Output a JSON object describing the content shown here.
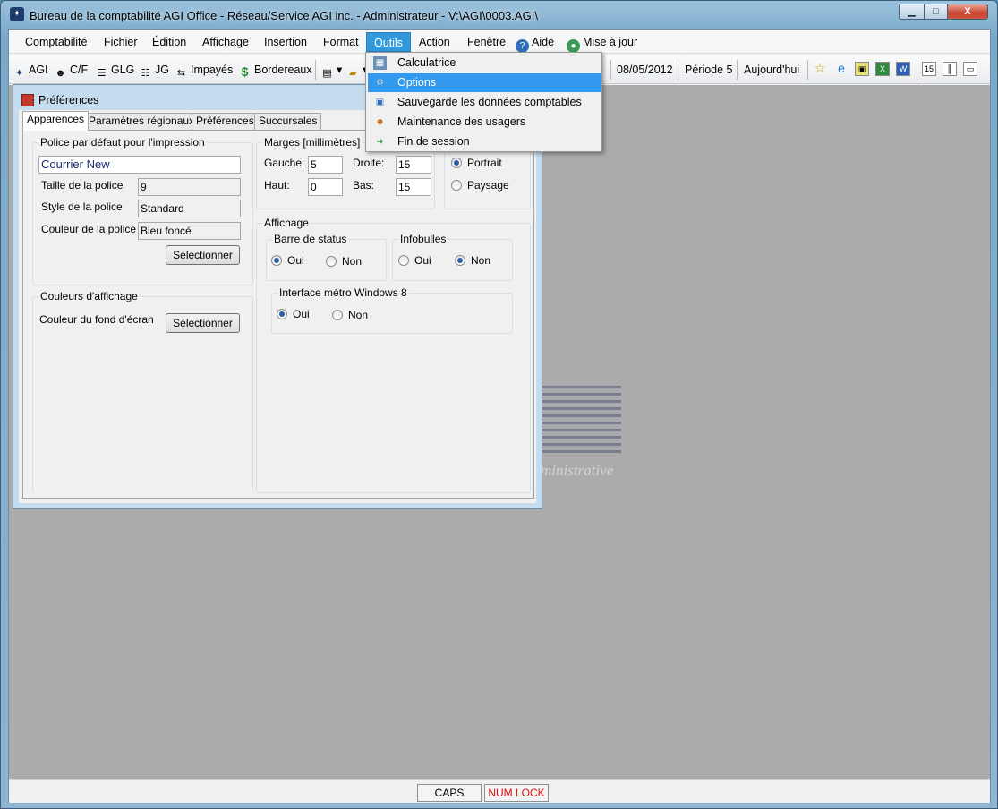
{
  "window": {
    "title": "Bureau de la comptabilité AGI Office - Réseau/Service AGI inc. - Administrateur - V:\\AGI\\0003.AGI\\",
    "min_label": "▁",
    "max_label": "□",
    "close_label": "X"
  },
  "menu": {
    "items": [
      "Comptabilité",
      "Fichier",
      "Édition",
      "Affichage",
      "Insertion",
      "Format",
      "Outils",
      "Action",
      "Fenêtre",
      "Aide",
      "Mise à jour"
    ],
    "active": "Outils"
  },
  "toolbar": {
    "agi": "AGI",
    "cf": "C/F",
    "glg": "GLG",
    "jg": "JG",
    "impayes": "Impayés",
    "bordereaux": "Bordereaux",
    "date": "08/05/2012",
    "periode": "Période 5",
    "aujourdhui": "Aujourd'hui"
  },
  "dropdown": {
    "items": [
      "Calculatrice",
      "Options",
      "Sauvegarde les données comptables",
      "Maintenance des usagers",
      "Fin de session"
    ],
    "highlighted": "Options"
  },
  "prefs": {
    "title": "Préférences",
    "tabs": [
      "Apparences",
      "Paramètres régionaux",
      "Préférences",
      "Succursales"
    ],
    "police_group": "Police par défaut pour l'impression",
    "font_name": "Courrier New",
    "taille_label": "Taille de la police",
    "taille_value": "9",
    "style_label": "Style de la police",
    "style_value": "Standard",
    "couleur_label": "Couleur de la police",
    "couleur_value": "Bleu foncé",
    "select_label": "Sélectionner",
    "couleurs_group": "Couleurs d'affichage",
    "fond_label": "Couleur du fond d'écran",
    "marges_group": "Marges [millimètres]",
    "gauche_label": "Gauche:",
    "gauche_value": "5",
    "droite_label": "Droite:",
    "droite_value": "15",
    "haut_label": "Haut:",
    "haut_value": "0",
    "bas_label": "Bas:",
    "bas_value": "15",
    "portrait": "Portrait",
    "paysage": "Paysage",
    "affichage_group": "Affichage",
    "barre_group": "Barre de status",
    "infobulles_group": "Infobulles",
    "metro_group": "Interface métro Windows 8",
    "oui": "Oui",
    "non": "Non"
  },
  "logo_text": "ministrative",
  "status": {
    "caps": "CAPS",
    "numlock": "NUM LOCK"
  },
  "colors": {
    "accent": "#3399dd",
    "numlock": "#e01010"
  }
}
